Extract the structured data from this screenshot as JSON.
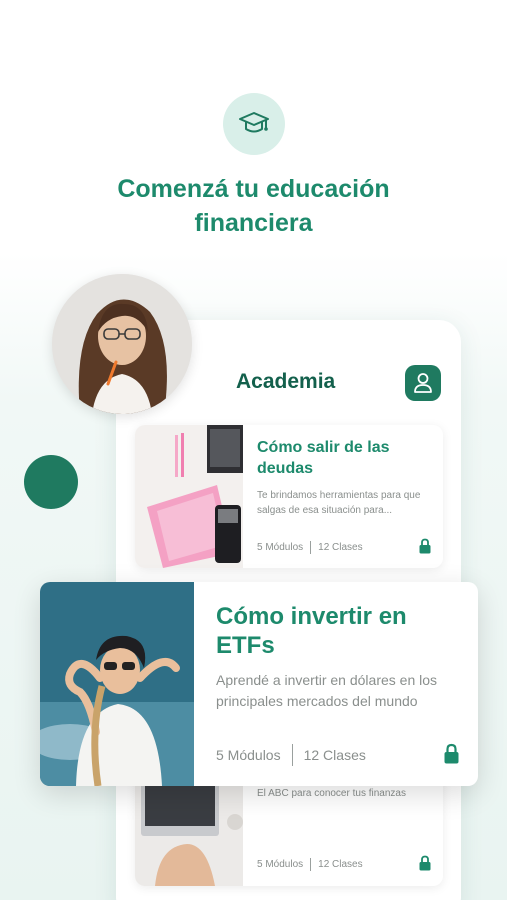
{
  "header": {
    "icon": "graduation-cap-icon",
    "headline": "Comenzá tu educación financiera"
  },
  "app": {
    "title": "Academia",
    "profile_icon": "user-icon"
  },
  "courses": [
    {
      "title": "Cómo salir de las deudas",
      "description": "Te brindamos herramientas para que salgas de esa situación para...",
      "modules": "5 Módulos",
      "classes": "12 Clases",
      "lock_icon": "lock-icon"
    },
    {
      "title": "Cómo invertir en ETFs",
      "description": "Aprendé a invertir en dólares en los principales mercados del mundo",
      "modules": "5 Módulos",
      "classes": "12 Clases",
      "lock_icon": "lock-icon"
    },
    {
      "title": "",
      "description": "El ABC para conocer tus finanzas",
      "modules": "5 Módulos",
      "classes": "12 Clases",
      "lock_icon": "lock-icon"
    }
  ],
  "colors": {
    "brand_green": "#1d8a6c",
    "dark_green": "#1f7a60",
    "light_mint": "#d9efe9"
  }
}
